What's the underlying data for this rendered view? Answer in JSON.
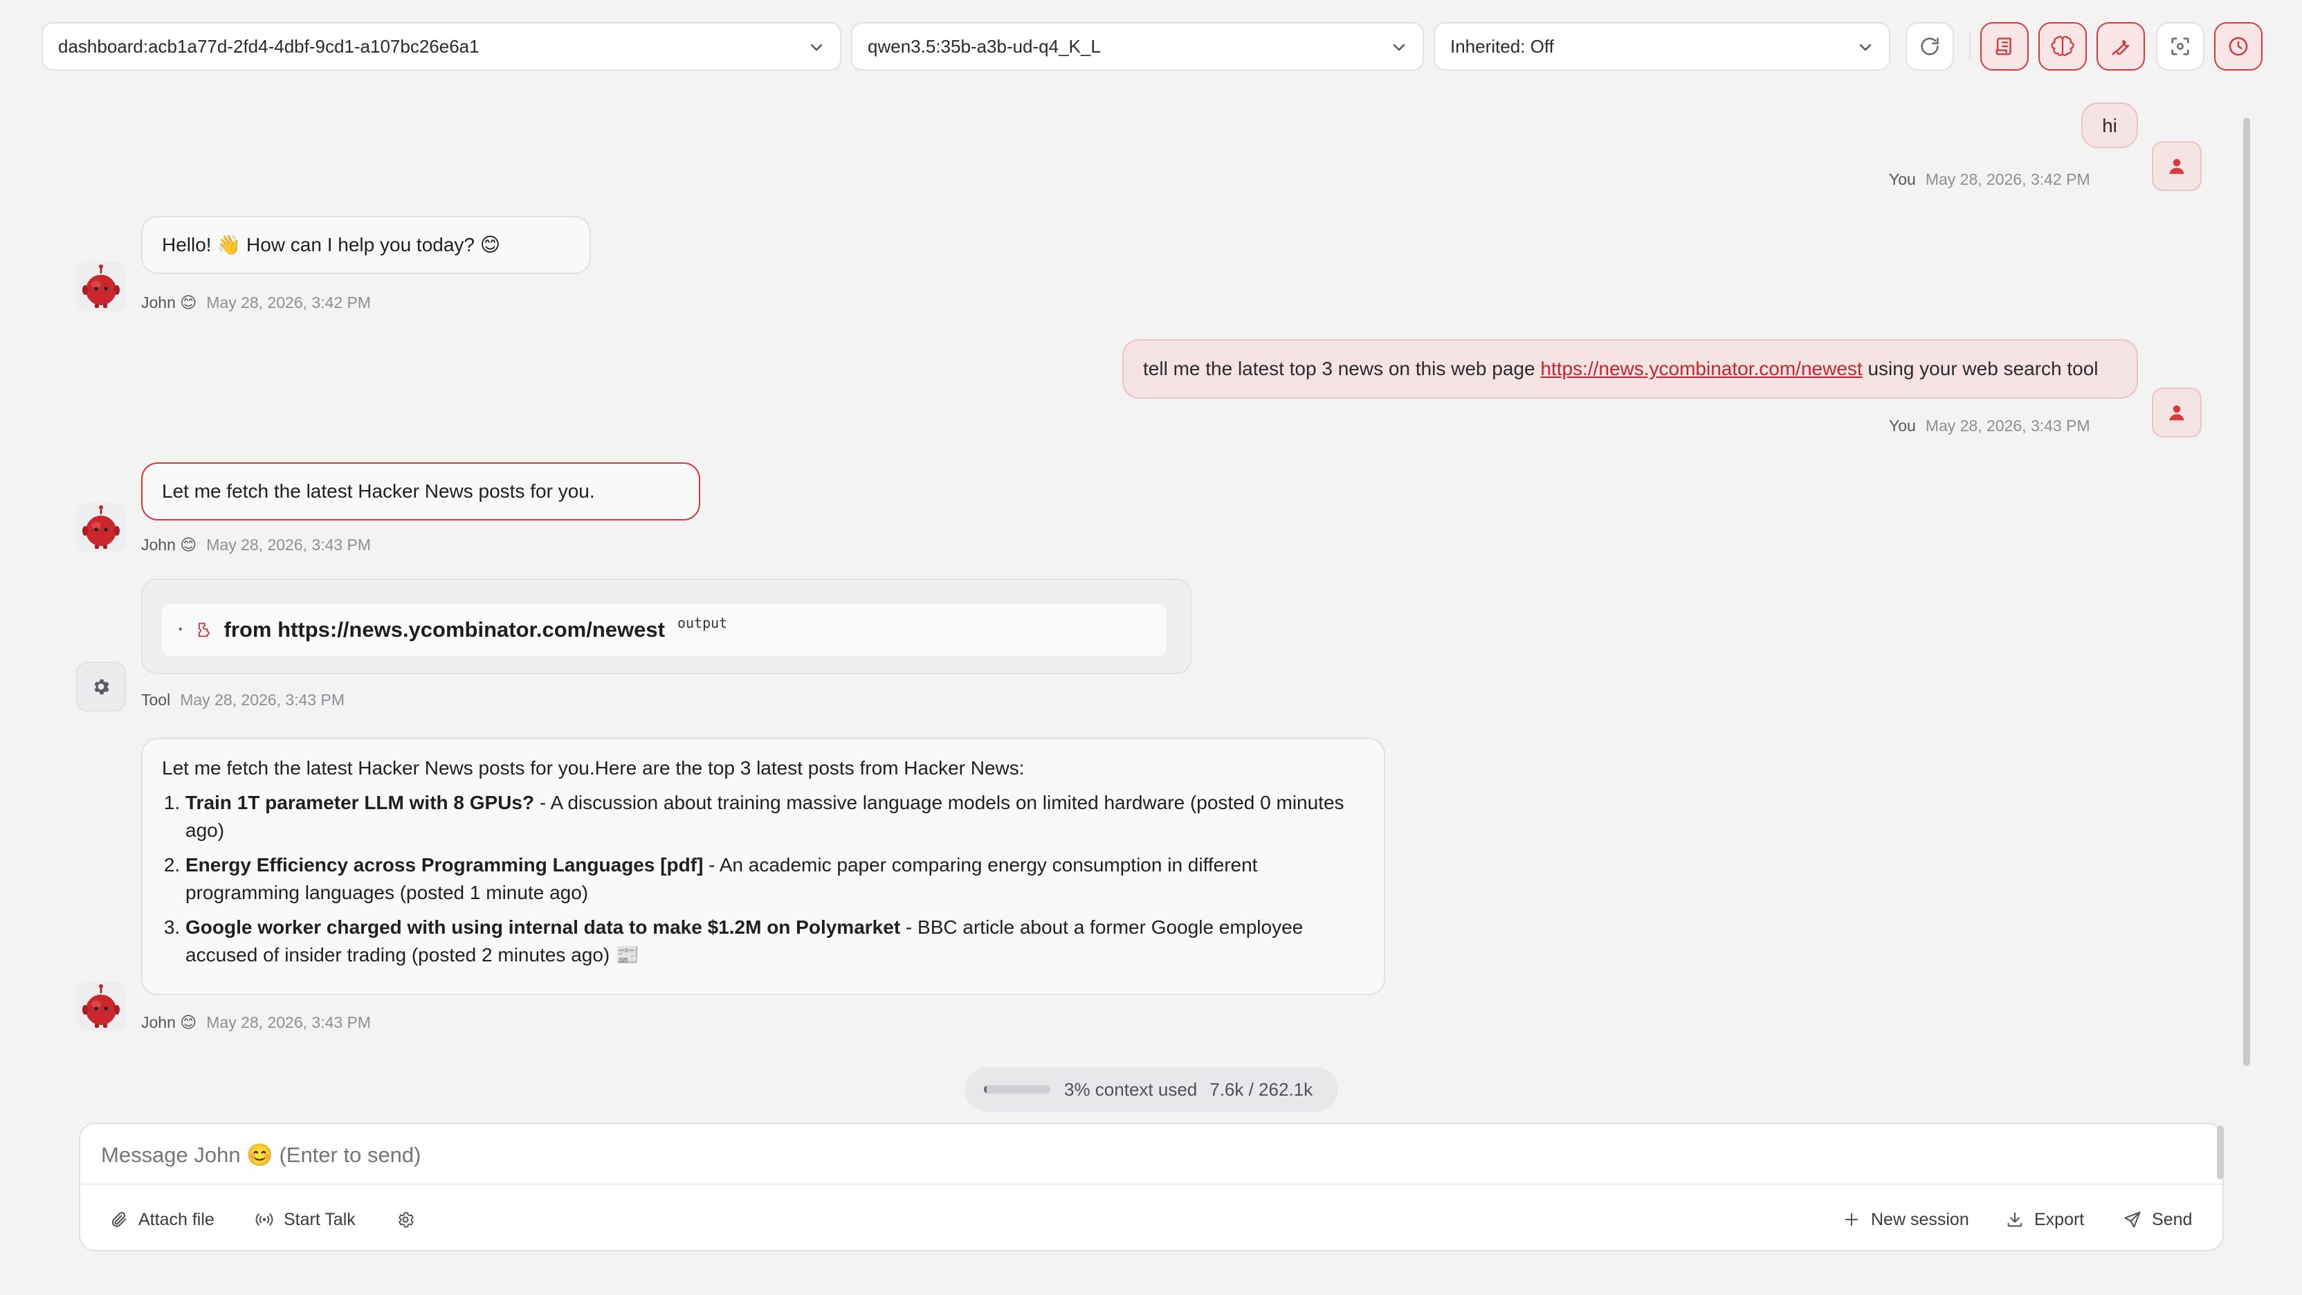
{
  "topbar": {
    "session_select": "dashboard:acb1a77d-2fd4-4dbf-9cd1-a107bc26e6a1",
    "model_select": "qwen3.5:35b-a3b-ud-q4_K_L",
    "inherit_select": "Inherited: Off"
  },
  "icons": {
    "accent": "#d8393f",
    "buttons": [
      "refresh-icon",
      "scroll-icon",
      "brain-icon",
      "wrench-icon",
      "screenshot-icon",
      "clock-icon"
    ]
  },
  "messages": [
    {
      "role": "user",
      "text": "hi",
      "author": "You",
      "time": "May 28, 2026, 3:42 PM"
    },
    {
      "role": "bot",
      "text": "Hello! 👋 How can I help you today? 😊",
      "author": "John 😊",
      "time": "May 28, 2026, 3:42 PM"
    },
    {
      "role": "user",
      "text_before": "tell me the latest top 3 news on this web page ",
      "link": "https://news.ycombinator.com/newest",
      "text_after": " using your web search tool",
      "author": "You",
      "time": "May 28, 2026, 3:43 PM"
    },
    {
      "role": "bot",
      "text": "Let me fetch the latest Hacker News posts for you.",
      "author": "John 😊",
      "time": "May 28, 2026, 3:43 PM"
    },
    {
      "role": "tool",
      "label": "from https://news.ycombinator.com/newest",
      "tag": "output",
      "author": "Tool",
      "time": "May 28, 2026, 3:43 PM"
    },
    {
      "role": "bot",
      "intro": "Let me fetch the latest Hacker News posts for you.Here are the top 3 latest posts from Hacker News:",
      "items": [
        {
          "title": "Train 1T parameter LLM with 8 GPUs?",
          "desc": " - A discussion about training massive language models on limited hardware (posted 0 minutes ago)"
        },
        {
          "title": "Energy Efficiency across Programming Languages [pdf]",
          "desc": " - An academic paper comparing energy consumption in different programming languages (posted 1 minute ago)"
        },
        {
          "title": "Google worker charged with using internal data to make $1.2M on Polymarket",
          "desc": " - BBC article about a former Google employee accused of insider trading (posted 2 minutes ago) 📰"
        }
      ],
      "author": "John 😊",
      "time": "May 28, 2026, 3:43 PM"
    }
  ],
  "context": {
    "label": "3% context used",
    "usage": "7.6k / 262.1k",
    "fraction": 0.03
  },
  "composer": {
    "placeholder": "Message John 😊 (Enter to send)",
    "attach": "Attach file",
    "talk": "Start Talk",
    "new_session": "New session",
    "export": "Export",
    "send": "Send"
  }
}
